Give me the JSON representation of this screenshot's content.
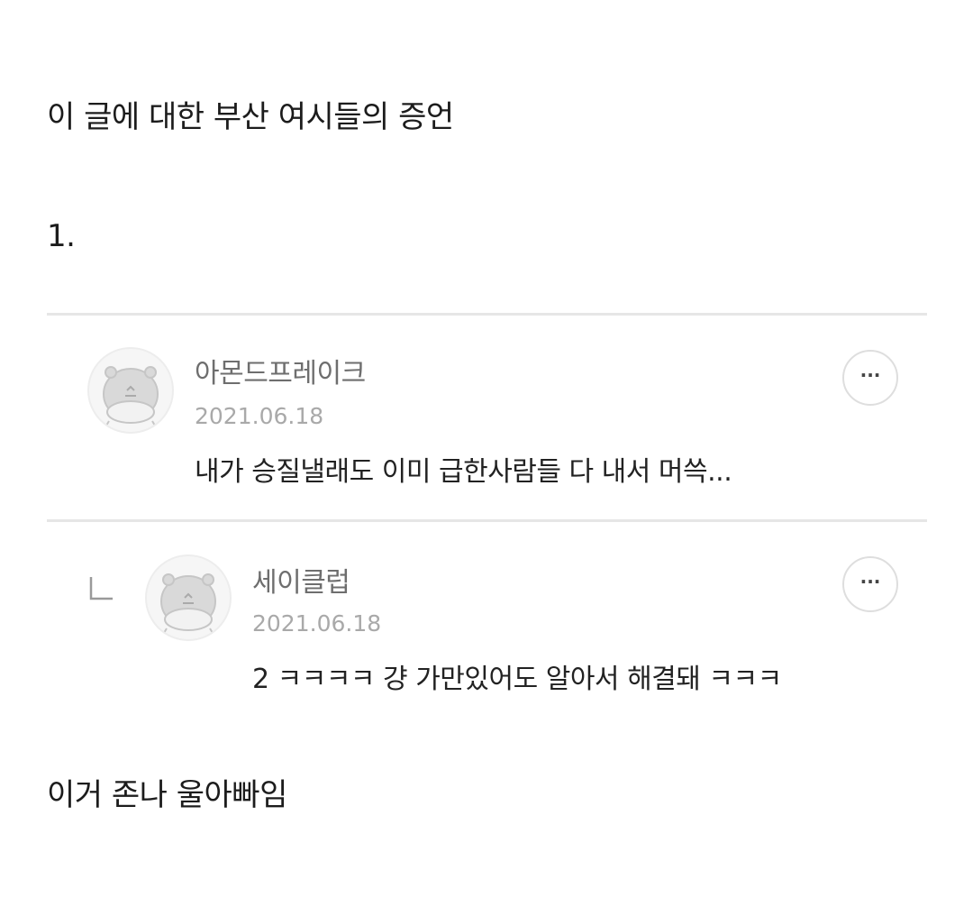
{
  "post": {
    "intro": "이 글에 대한 부산 여시들의 증언",
    "number": "1.",
    "outro": "이거 존나 울아빠임"
  },
  "comments": [
    {
      "author": "아몬드프레이크",
      "date": "2021.06.18",
      "text": "내가 승질낼래도 이미 급한사람들 다 내서 머쓱...",
      "more_icon": "more-horizontal-icon",
      "avatar_icon": "hamster-avatar-icon"
    }
  ],
  "reply": {
    "author": "세이클럽",
    "date": "2021.06.18",
    "text": "2 ㅋㅋㅋㅋ 걍 가만있어도 알아서 해결돼 ㅋㅋㅋ",
    "more_icon": "more-horizontal-icon",
    "reply_icon": "reply-corner-icon",
    "avatar_icon": "hamster-avatar-icon"
  },
  "ui": {
    "more_label": "···"
  },
  "colors": {
    "divider": "#e6e6e6",
    "author": "#6e6e6e",
    "date": "#a9a9a9",
    "text": "#222222"
  }
}
